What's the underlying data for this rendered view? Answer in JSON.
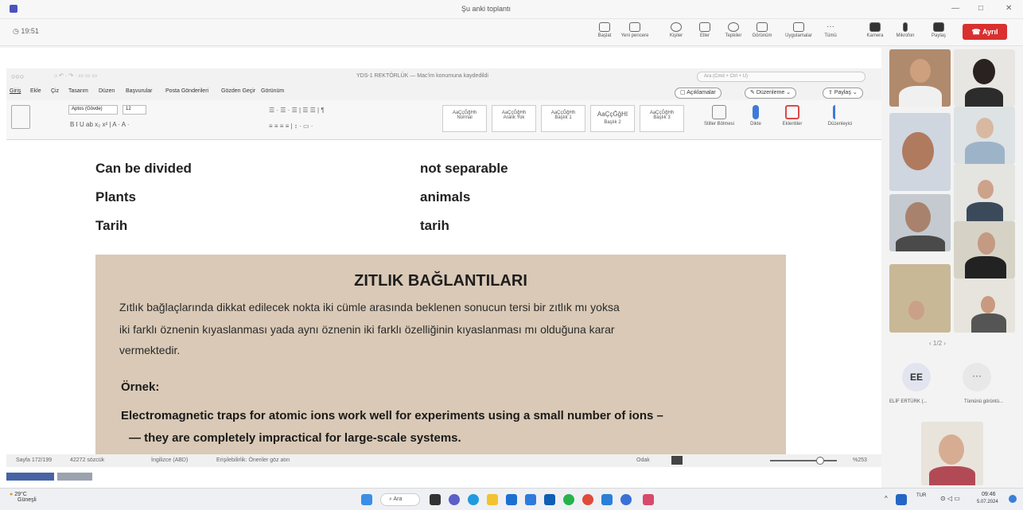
{
  "meeting": {
    "title": "Şu anki toplantı",
    "timer": "19:51",
    "toolbar": [
      {
        "label": "Başlat",
        "icon": "share-screen-icon"
      },
      {
        "label": "Yeni pencere",
        "icon": "new-window-icon"
      },
      {
        "label": "Kişiler",
        "icon": "people-icon"
      },
      {
        "label": "Eller",
        "icon": "hand-icon"
      },
      {
        "label": "Tepkiler",
        "icon": "reaction-icon"
      },
      {
        "label": "Görünüm",
        "icon": "view-icon"
      },
      {
        "label": "Uygulamalar",
        "icon": "apps-icon"
      },
      {
        "label": "Tümü",
        "icon": "more-icon"
      },
      {
        "label": "Kamera",
        "icon": "camera-icon"
      },
      {
        "label": "Mikrofon",
        "icon": "mic-icon"
      },
      {
        "label": "Paylaş",
        "icon": "share-icon"
      }
    ],
    "leave_label": "Ayrıl",
    "leave_color": "#d93030"
  },
  "word": {
    "title": "YDS-1 REKTÖRLÜK — Mac'im konumuna kaydedildi",
    "search_placeholder": "Ara (Cmd + Ctrl + U)",
    "menu": [
      "Giriş",
      "Ekle",
      "Çiz",
      "Tasarım",
      "Düzen",
      "Başvurular",
      "Posta Gönderileri",
      "Gözden Geçir",
      "Görünüm"
    ],
    "buttons": {
      "comments": "Açıklamalar",
      "editing": "Düzenleme",
      "share": "Paylaş"
    },
    "font_name": "Aptos (Gövde)",
    "font_size": "12",
    "styles": [
      "AaÇçĞğHh",
      "AaÇçĞğHh",
      "AaÇçĞğHh",
      "AaÇçĞğHI",
      "AaÇçĞğHh"
    ],
    "style_names": [
      "Normal",
      "Aralık Yok",
      "Başlık 1",
      "Başlık 2",
      "Başlık 3"
    ],
    "ribbon_right": [
      "Stiller Bölmesi",
      "Dikte",
      "Eklentiler",
      "Düzenleyici"
    ],
    "status": {
      "page": "Sayfa 172/199",
      "words": "42272 sözcük",
      "lang": "İngilizce (ABD)",
      "accessibility": "Erişilebilirlik: Öneriler göz atın",
      "focus": "Odak",
      "zoom": "%253"
    }
  },
  "doc": {
    "rows": [
      {
        "left": "Can be divided",
        "right": "not separable"
      },
      {
        "left": "Plants",
        "right": "animals"
      },
      {
        "left": "Tarih",
        "right": "tarih"
      }
    ],
    "scan": {
      "title": "ZITLIK BAĞLANTILARI",
      "para1": "Zıtlık bağlaçlarında dikkat edilecek nokta iki cümle arasında beklenen sonucun tersi bir zıtlık mı yoksa",
      "para2": "iki farklı öznenin kıyaslanması yada aynı öznenin iki farklı özelliğinin kıyaslanması mı olduğuna karar",
      "para3": "vermektedir.",
      "example_label": "Örnek:",
      "example1": "Electromagnetic traps for atomic ions work well for experiments using a small number of ions –",
      "example2": "— they are completely impractical for large-scale systems."
    }
  },
  "participants": {
    "page_indicator": "1/2",
    "initials": "EE",
    "name": "ELİF ERTÜRK (...",
    "more_label": "Tümünü görüntü..."
  },
  "taskbar": {
    "weather_temp": "29°C",
    "weather_desc": "Güneşli",
    "search": "Ara",
    "lang": "TUR",
    "time": "09:46",
    "date": "5.07.2024"
  }
}
